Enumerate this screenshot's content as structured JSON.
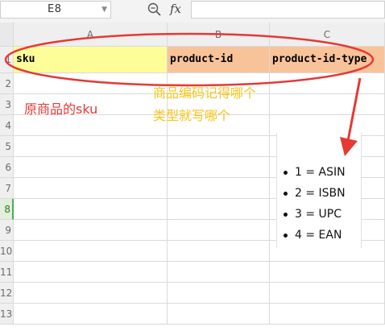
{
  "formula_bar": {
    "cell_ref": "E8",
    "fx_symbol": "fx",
    "formula_value": ""
  },
  "columns": [
    "A",
    "B",
    "C"
  ],
  "rows": [
    "1",
    "2",
    "3",
    "4",
    "5",
    "6",
    "7",
    "8",
    "9",
    "10",
    "11",
    "12",
    "13"
  ],
  "selected_row": "8",
  "header_row": {
    "a": "sku",
    "b": "product-id",
    "c": "product-id-type"
  },
  "annotations": {
    "sku_note": "原商品的sku",
    "type_note_line1": "商品编码记得哪个",
    "type_note_line2": "类型就写哪个"
  },
  "type_list": [
    {
      "label": "1 = ASIN"
    },
    {
      "label": "2 = ISBN"
    },
    {
      "label": "3 = UPC"
    },
    {
      "label": "4 = EAN"
    }
  ],
  "colors": {
    "header_yellow": "#fefe99",
    "header_orange": "#f9c39a",
    "annotation_red": "#e53935",
    "annotation_yellow": "#f5c518",
    "selection_green": "#4caf50"
  }
}
